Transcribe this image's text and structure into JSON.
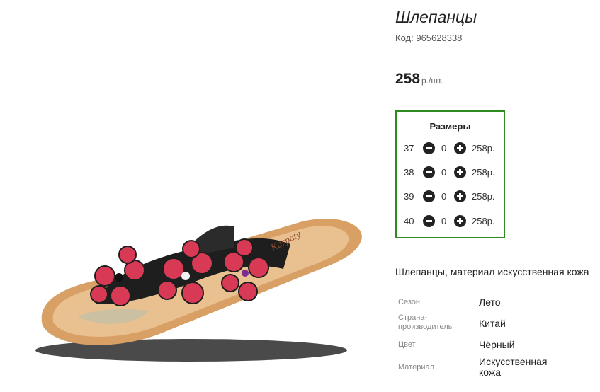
{
  "product": {
    "title": "Шлепанцы",
    "code_label": "Код:",
    "code": "965628338",
    "price": "258",
    "price_unit": "р./шт.",
    "image_logo_text": "Karpaty"
  },
  "sizes": {
    "title": "Размеры",
    "rows": [
      {
        "size": "37",
        "qty": "0",
        "price": "258р."
      },
      {
        "size": "38",
        "qty": "0",
        "price": "258р."
      },
      {
        "size": "39",
        "qty": "0",
        "price": "258р."
      },
      {
        "size": "40",
        "qty": "0",
        "price": "258р."
      }
    ]
  },
  "description": "Шлепанцы, материал искусственная кожа",
  "specs": [
    {
      "label": "Сезон",
      "value": "Лето"
    },
    {
      "label": "Страна-\nпроизводитель",
      "value": "Китай"
    },
    {
      "label": "Цвет",
      "value": "Чёрный"
    },
    {
      "label": "Материал",
      "value": "Искусственная\nкожа"
    }
  ],
  "colors": {
    "accent_border": "#2e8b1f",
    "flower": "#d83a55"
  }
}
